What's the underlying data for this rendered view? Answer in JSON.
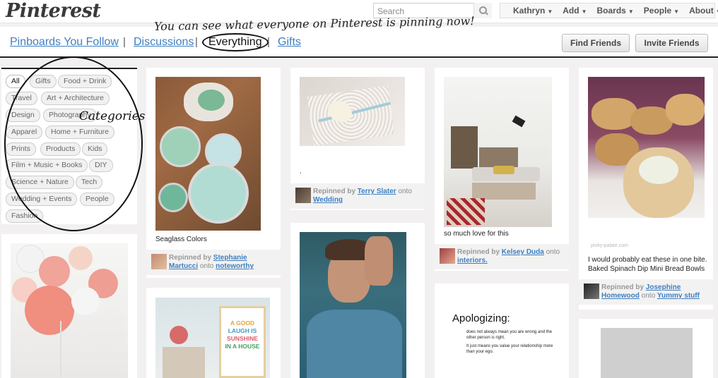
{
  "header": {
    "logo": "Pinterest",
    "search_placeholder": "Search",
    "nav": [
      {
        "label": "Kathryn"
      },
      {
        "label": "Add"
      },
      {
        "label": "Boards"
      },
      {
        "label": "People"
      },
      {
        "label": "About"
      }
    ]
  },
  "subnav": {
    "tabs": [
      "Pinboards You Follow",
      "Discussions",
      "Everything",
      "Gifts"
    ],
    "annotation": "You can see what everyone on Pinterest is pinning now!",
    "find_friends": "Find Friends",
    "invite_friends": "Invite Friends"
  },
  "categories": {
    "annotation": "Categories",
    "items": [
      "All",
      "Gifts",
      "Food + Drink",
      "Travel",
      "Art + Architecture",
      "Design",
      "Photography",
      "Apparel",
      "Home + Furniture",
      "Prints",
      "Products",
      "Kids",
      "Film + Music + Books",
      "DIY",
      "Science + Nature",
      "Tech",
      "Wedding + Events",
      "People",
      "Fashion"
    ]
  },
  "pins": {
    "p1": {
      "desc": "Seaglass Colors",
      "repinned": "Repinned by",
      "user": "Stephanie Martucci",
      "onto": "onto",
      "board": "noteworthy"
    },
    "p2": {
      "desc": ".",
      "repinned": "Repinned by",
      "user": "Terry Slater",
      "onto": "onto",
      "board": "Wedding"
    },
    "p3": {
      "desc": "so much love for this",
      "repinned": "Repinned by",
      "user": "Kelsey Duda",
      "onto": "onto",
      "board": "interiors."
    },
    "p4": {
      "desc": "I would probably eat these in one bite. Baked Spinach Dip Mini Bread Bowls",
      "repinned": "Repinned by",
      "user": "Josephine Homewood",
      "onto": "onto",
      "board": "Yummy stuff",
      "watermark": "pinky-palate.com"
    },
    "apologizing": {
      "title": "Apologizing:",
      "line1": "does not always mean you are wrong and the other person is right.",
      "line2": "It just means you value your relationship more than your ego."
    },
    "poster": {
      "l1": "A GOOD",
      "l2": "LAUGH IS",
      "l3": "SUNSHINE",
      "l4": "IN A HOUSE"
    }
  }
}
